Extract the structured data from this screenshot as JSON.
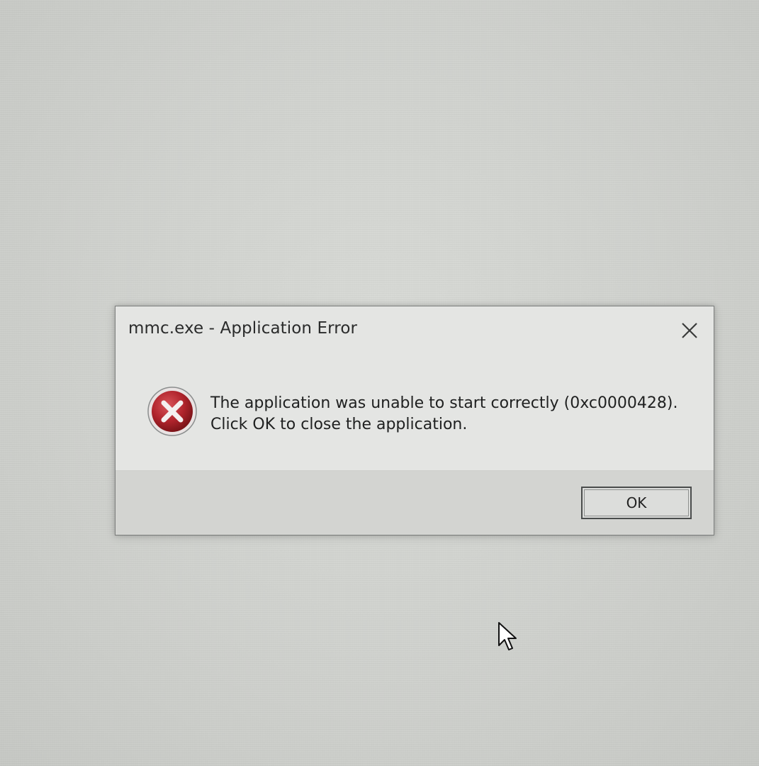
{
  "dialog": {
    "title": "mmc.exe - Application Error",
    "close_icon": "close-icon",
    "error_icon": "error-icon",
    "message_line_1": "The application was unable to start correctly (0xc0000428).",
    "message_line_2": "Click OK to close the application.",
    "ok_label": "OK"
  },
  "cursor": {
    "icon": "mouse-pointer-icon"
  },
  "colors": {
    "error_red": "#b0242c",
    "dialog_background": "#e4e5e3",
    "button_bar": "#d3d4d1"
  }
}
